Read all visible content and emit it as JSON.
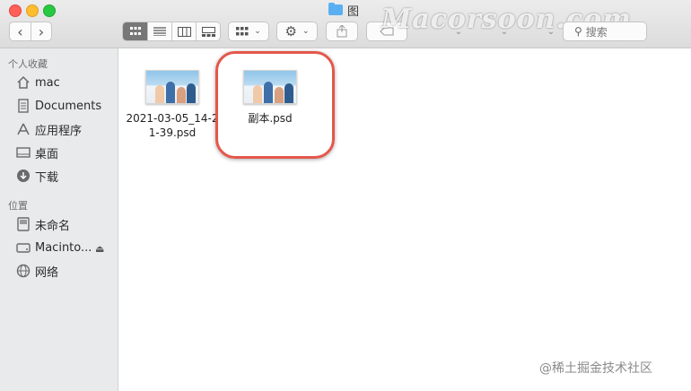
{
  "window": {
    "title": "图"
  },
  "watermark": "Macorsoon.com",
  "toolbar": {
    "nav_back": "‹",
    "nav_forward": "›",
    "view_modes": [
      "icons",
      "list",
      "columns",
      "gallery"
    ],
    "group_icon": "grid-icon",
    "action_icon": "gear-icon",
    "share_icon": "share-icon",
    "tag_icon": "tag-icon",
    "search_placeholder": "搜索"
  },
  "sidebar": {
    "favorites_heading": "个人收藏",
    "favorites": [
      {
        "label": "mac",
        "icon": "home-icon"
      },
      {
        "label": "Documents",
        "icon": "document-icon"
      },
      {
        "label": "应用程序",
        "icon": "applications-icon"
      },
      {
        "label": "桌面",
        "icon": "desktop-icon"
      },
      {
        "label": "下载",
        "icon": "download-icon"
      }
    ],
    "locations_heading": "位置",
    "locations": [
      {
        "label": "未命名",
        "icon": "disk-icon"
      },
      {
        "label": "Macinto...",
        "icon": "hard-drive-icon"
      },
      {
        "label": "网络",
        "icon": "network-icon"
      }
    ]
  },
  "files": [
    {
      "name_line1": "2021-03-05_14-2",
      "name_line2": "1-39.psd"
    },
    {
      "name_line1": "副本.psd",
      "name_line2": ""
    }
  ],
  "footer_watermark": "@稀土掘金技术社区",
  "colors": {
    "highlight": "#e4574b",
    "sidebar_bg": "#e9eaec",
    "folder": "#5aaff3"
  }
}
